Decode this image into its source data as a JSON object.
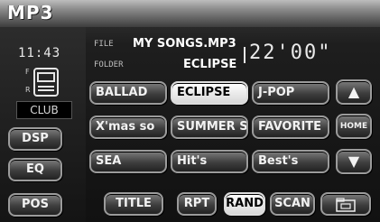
{
  "header": {
    "title": "MP3"
  },
  "status": {
    "clock": "11:43",
    "mode_label": "CLUB",
    "disc_marks": [
      "F",
      "R"
    ]
  },
  "track": {
    "file_label": "FILE",
    "file_name": "MY SONGS.MP3",
    "folder_label": "FOLDER",
    "folder_name": "ECLIPSE",
    "time": "22'00\""
  },
  "folders": [
    {
      "label": "BALLAD",
      "active": false
    },
    {
      "label": "ECLIPSE",
      "active": true
    },
    {
      "label": "J-POP",
      "active": false
    },
    {
      "label": "X'mas so",
      "active": false
    },
    {
      "label": "SUMMER S",
      "active": false
    },
    {
      "label": "FAVORITE",
      "active": false
    },
    {
      "label": "SEA",
      "active": false
    },
    {
      "label": "Hit's",
      "active": false
    },
    {
      "label": "Best's",
      "active": false
    }
  ],
  "side_buttons": {
    "dsp": "DSP",
    "eq": "EQ",
    "pos": "POS"
  },
  "right_controls": {
    "up_icon": "▲",
    "home": "HOME",
    "down_icon": "▼"
  },
  "bottom_buttons": {
    "title": "TITLE",
    "rpt": "RPT",
    "rand": "RAND",
    "scan": "SCAN",
    "folder_icon": "folder-icon"
  }
}
